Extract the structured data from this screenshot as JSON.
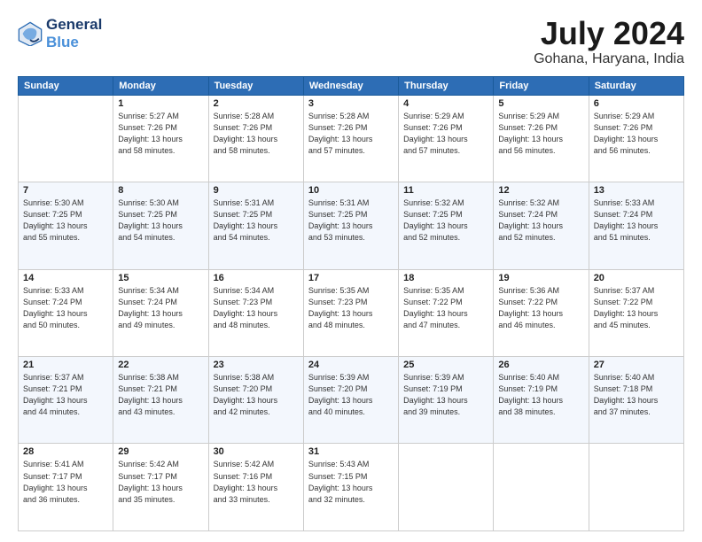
{
  "header": {
    "logo_line1": "General",
    "logo_line2": "Blue",
    "month_title": "July 2024",
    "location": "Gohana, Haryana, India"
  },
  "weekdays": [
    "Sunday",
    "Monday",
    "Tuesday",
    "Wednesday",
    "Thursday",
    "Friday",
    "Saturday"
  ],
  "weeks": [
    [
      {
        "day": "",
        "info": ""
      },
      {
        "day": "1",
        "info": "Sunrise: 5:27 AM\nSunset: 7:26 PM\nDaylight: 13 hours\nand 58 minutes."
      },
      {
        "day": "2",
        "info": "Sunrise: 5:28 AM\nSunset: 7:26 PM\nDaylight: 13 hours\nand 58 minutes."
      },
      {
        "day": "3",
        "info": "Sunrise: 5:28 AM\nSunset: 7:26 PM\nDaylight: 13 hours\nand 57 minutes."
      },
      {
        "day": "4",
        "info": "Sunrise: 5:29 AM\nSunset: 7:26 PM\nDaylight: 13 hours\nand 57 minutes."
      },
      {
        "day": "5",
        "info": "Sunrise: 5:29 AM\nSunset: 7:26 PM\nDaylight: 13 hours\nand 56 minutes."
      },
      {
        "day": "6",
        "info": "Sunrise: 5:29 AM\nSunset: 7:26 PM\nDaylight: 13 hours\nand 56 minutes."
      }
    ],
    [
      {
        "day": "7",
        "info": "Sunrise: 5:30 AM\nSunset: 7:25 PM\nDaylight: 13 hours\nand 55 minutes."
      },
      {
        "day": "8",
        "info": "Sunrise: 5:30 AM\nSunset: 7:25 PM\nDaylight: 13 hours\nand 54 minutes."
      },
      {
        "day": "9",
        "info": "Sunrise: 5:31 AM\nSunset: 7:25 PM\nDaylight: 13 hours\nand 54 minutes."
      },
      {
        "day": "10",
        "info": "Sunrise: 5:31 AM\nSunset: 7:25 PM\nDaylight: 13 hours\nand 53 minutes."
      },
      {
        "day": "11",
        "info": "Sunrise: 5:32 AM\nSunset: 7:25 PM\nDaylight: 13 hours\nand 52 minutes."
      },
      {
        "day": "12",
        "info": "Sunrise: 5:32 AM\nSunset: 7:24 PM\nDaylight: 13 hours\nand 52 minutes."
      },
      {
        "day": "13",
        "info": "Sunrise: 5:33 AM\nSunset: 7:24 PM\nDaylight: 13 hours\nand 51 minutes."
      }
    ],
    [
      {
        "day": "14",
        "info": "Sunrise: 5:33 AM\nSunset: 7:24 PM\nDaylight: 13 hours\nand 50 minutes."
      },
      {
        "day": "15",
        "info": "Sunrise: 5:34 AM\nSunset: 7:24 PM\nDaylight: 13 hours\nand 49 minutes."
      },
      {
        "day": "16",
        "info": "Sunrise: 5:34 AM\nSunset: 7:23 PM\nDaylight: 13 hours\nand 48 minutes."
      },
      {
        "day": "17",
        "info": "Sunrise: 5:35 AM\nSunset: 7:23 PM\nDaylight: 13 hours\nand 48 minutes."
      },
      {
        "day": "18",
        "info": "Sunrise: 5:35 AM\nSunset: 7:22 PM\nDaylight: 13 hours\nand 47 minutes."
      },
      {
        "day": "19",
        "info": "Sunrise: 5:36 AM\nSunset: 7:22 PM\nDaylight: 13 hours\nand 46 minutes."
      },
      {
        "day": "20",
        "info": "Sunrise: 5:37 AM\nSunset: 7:22 PM\nDaylight: 13 hours\nand 45 minutes."
      }
    ],
    [
      {
        "day": "21",
        "info": "Sunrise: 5:37 AM\nSunset: 7:21 PM\nDaylight: 13 hours\nand 44 minutes."
      },
      {
        "day": "22",
        "info": "Sunrise: 5:38 AM\nSunset: 7:21 PM\nDaylight: 13 hours\nand 43 minutes."
      },
      {
        "day": "23",
        "info": "Sunrise: 5:38 AM\nSunset: 7:20 PM\nDaylight: 13 hours\nand 42 minutes."
      },
      {
        "day": "24",
        "info": "Sunrise: 5:39 AM\nSunset: 7:20 PM\nDaylight: 13 hours\nand 40 minutes."
      },
      {
        "day": "25",
        "info": "Sunrise: 5:39 AM\nSunset: 7:19 PM\nDaylight: 13 hours\nand 39 minutes."
      },
      {
        "day": "26",
        "info": "Sunrise: 5:40 AM\nSunset: 7:19 PM\nDaylight: 13 hours\nand 38 minutes."
      },
      {
        "day": "27",
        "info": "Sunrise: 5:40 AM\nSunset: 7:18 PM\nDaylight: 13 hours\nand 37 minutes."
      }
    ],
    [
      {
        "day": "28",
        "info": "Sunrise: 5:41 AM\nSunset: 7:17 PM\nDaylight: 13 hours\nand 36 minutes."
      },
      {
        "day": "29",
        "info": "Sunrise: 5:42 AM\nSunset: 7:17 PM\nDaylight: 13 hours\nand 35 minutes."
      },
      {
        "day": "30",
        "info": "Sunrise: 5:42 AM\nSunset: 7:16 PM\nDaylight: 13 hours\nand 33 minutes."
      },
      {
        "day": "31",
        "info": "Sunrise: 5:43 AM\nSunset: 7:15 PM\nDaylight: 13 hours\nand 32 minutes."
      },
      {
        "day": "",
        "info": ""
      },
      {
        "day": "",
        "info": ""
      },
      {
        "day": "",
        "info": ""
      }
    ]
  ]
}
